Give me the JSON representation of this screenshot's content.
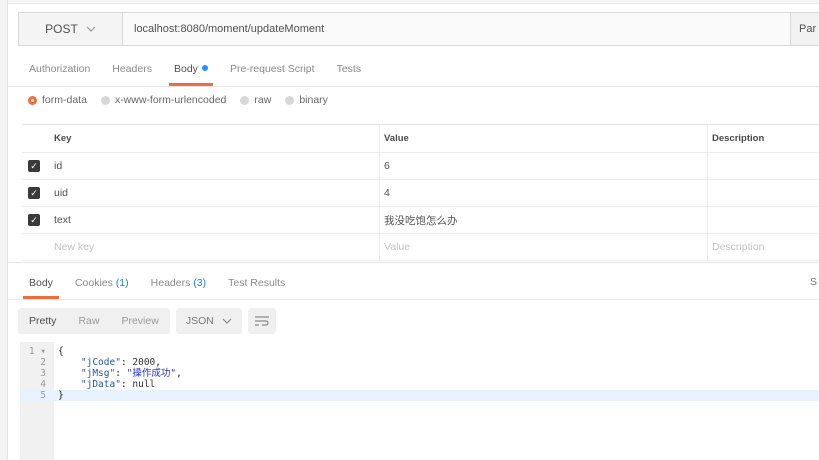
{
  "request": {
    "method": "POST",
    "url": "localhost:8080/moment/updateMoment",
    "params_label": "Par"
  },
  "tabs": [
    {
      "label": "Authorization",
      "active": false
    },
    {
      "label": "Headers",
      "active": false
    },
    {
      "label": "Body",
      "active": true
    },
    {
      "label": "Pre-request Script",
      "active": false
    },
    {
      "label": "Tests",
      "active": false
    }
  ],
  "body_types": [
    {
      "label": "form-data",
      "selected": true
    },
    {
      "label": "x-www-form-urlencoded",
      "selected": false
    },
    {
      "label": "raw",
      "selected": false
    },
    {
      "label": "binary",
      "selected": false
    }
  ],
  "table": {
    "headers": {
      "key": "Key",
      "value": "Value",
      "description": "Description"
    },
    "rows": [
      {
        "checked": true,
        "key": "id",
        "value": "6",
        "description": ""
      },
      {
        "checked": true,
        "key": "uid",
        "value": "4",
        "description": ""
      },
      {
        "checked": true,
        "key": "text",
        "value": "我没吃饱怎么办",
        "description": ""
      }
    ],
    "placeholders": {
      "key": "New key",
      "value": "Value",
      "description": "Description"
    }
  },
  "response": {
    "tabs": [
      {
        "label": "Body",
        "count": "",
        "active": true
      },
      {
        "label": "Cookies",
        "count": "(1)",
        "active": false
      },
      {
        "label": "Headers",
        "count": "(3)",
        "active": false
      },
      {
        "label": "Test Results",
        "count": "",
        "active": false
      }
    ],
    "status_char": "S",
    "view_modes": [
      "Pretty",
      "Raw",
      "Preview"
    ],
    "format": "JSON",
    "code_lines": [
      {
        "n": "1",
        "text": "{"
      },
      {
        "n": "2",
        "key": "\"jCode\"",
        "value": "2000",
        "tail": ","
      },
      {
        "n": "3",
        "key": "\"jMsg\"",
        "value": "\"操作成功\"",
        "tail": ","
      },
      {
        "n": "4",
        "key": "\"jData\"",
        "value": "null",
        "tail": ""
      },
      {
        "n": "5",
        "text": "}"
      }
    ]
  },
  "colors": {
    "accent": "#f26b3a",
    "link": "#1e7fd8",
    "dot": "#1e90ff"
  }
}
